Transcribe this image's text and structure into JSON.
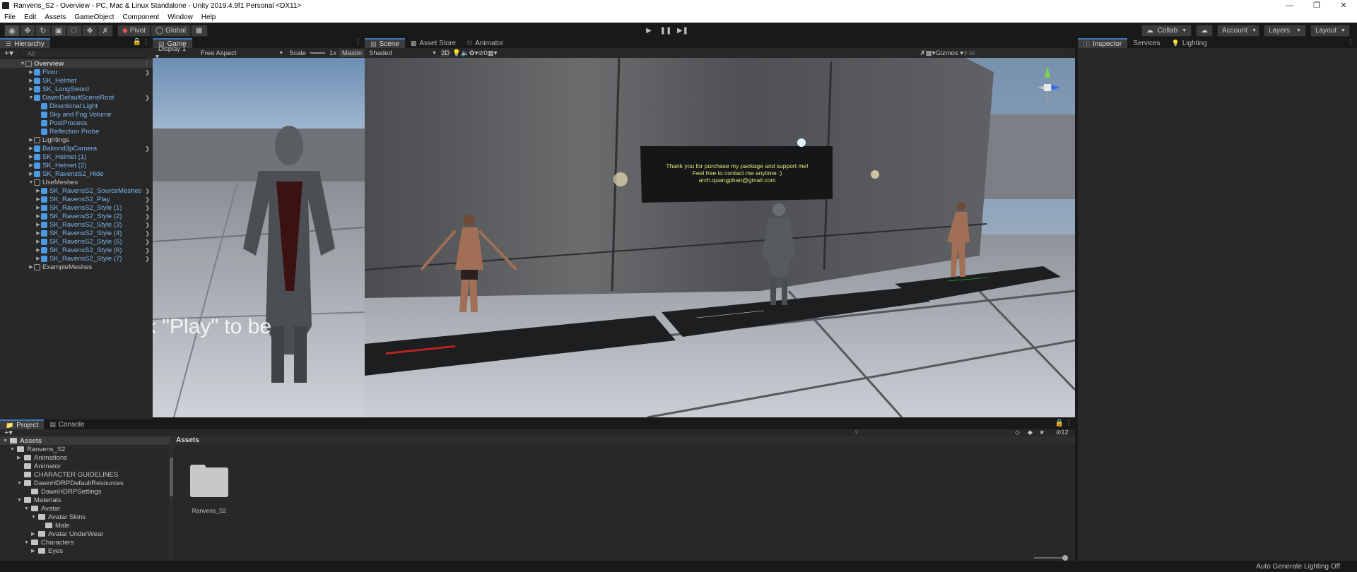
{
  "window": {
    "title": "Ranvens_S2 - Overview - PC, Mac & Linux Standalone - Unity 2019.4.9f1 Personal <DX11>"
  },
  "menu": [
    "File",
    "Edit",
    "Assets",
    "GameObject",
    "Component",
    "Window",
    "Help"
  ],
  "toolbar": {
    "pivot": "Pivot",
    "global": "Global",
    "collab": "Collab",
    "account": "Account",
    "layers": "Layers",
    "layout": "Layout"
  },
  "hierarchy": {
    "tab": "Hierarchy",
    "search_placeholder": "All",
    "items": [
      {
        "label": "Overview",
        "depth": 0,
        "open": true,
        "scene": true
      },
      {
        "label": "Floor",
        "depth": 1,
        "blue": true,
        "chev": true
      },
      {
        "label": "SK_Helmet",
        "depth": 1,
        "blue": true
      },
      {
        "label": "SK_LongSword",
        "depth": 1,
        "blue": true
      },
      {
        "label": "DawnDefaultSceneRoot",
        "depth": 1,
        "blue": true,
        "open": true,
        "chev": true
      },
      {
        "label": "Directional Light",
        "depth": 2,
        "blue": true
      },
      {
        "label": "Sky and Fog Volume",
        "depth": 2,
        "blue": true
      },
      {
        "label": "PostProcess",
        "depth": 2,
        "blue": true
      },
      {
        "label": "Reflection Probe",
        "depth": 2,
        "blue": true
      },
      {
        "label": "Lightings",
        "depth": 1
      },
      {
        "label": "Balrond3pCamera",
        "depth": 1,
        "blue": true,
        "chev": true
      },
      {
        "label": "SK_Helmet (1)",
        "depth": 1,
        "blue": true
      },
      {
        "label": "SK_Helmet (2)",
        "depth": 1,
        "blue": true
      },
      {
        "label": "SK_RavensS2_Hide",
        "depth": 1,
        "blue": true
      },
      {
        "label": "UseMeshes",
        "depth": 1,
        "open": true
      },
      {
        "label": "SK_RavensS2_SourceMeshes",
        "depth": 2,
        "blue": true,
        "chev": true
      },
      {
        "label": "SK_RavensS2_Play",
        "depth": 2,
        "blue": true,
        "chev": true
      },
      {
        "label": "SK_RavensS2_Style (1)",
        "depth": 2,
        "blue": true,
        "chev": true
      },
      {
        "label": "SK_RavensS2_Style (2)",
        "depth": 2,
        "blue": true,
        "chev": true
      },
      {
        "label": "SK_RavensS2_Style (3)",
        "depth": 2,
        "blue": true,
        "chev": true
      },
      {
        "label": "SK_RavensS2_Style (4)",
        "depth": 2,
        "blue": true,
        "chev": true
      },
      {
        "label": "SK_RavensS2_Style (5)",
        "depth": 2,
        "blue": true,
        "chev": true
      },
      {
        "label": "SK_RavensS2_Style (6)",
        "depth": 2,
        "blue": true,
        "chev": true
      },
      {
        "label": "SK_RavensS2_Style (7)",
        "depth": 2,
        "blue": true,
        "chev": true
      },
      {
        "label": "ExampleMeshes",
        "depth": 1
      }
    ]
  },
  "game": {
    "tab": "Game",
    "display": "Display 1",
    "aspect": "Free Aspect",
    "scale_label": "Scale",
    "scale_value": "1x",
    "maximize": "Maxim",
    "overlay_text": "k \"Play\" to be"
  },
  "scene": {
    "tabs": [
      "Scene",
      "Asset Store",
      "Animator"
    ],
    "shading": "Shaded",
    "mode2d": "2D",
    "fx_count": "0",
    "gizmos": "Gizmos",
    "search_placeholder": "All",
    "sign_text": [
      "Thank you for purchase my package and support me!",
      "Feel free to contact me anytime :)",
      "arch.quangphan@gmail.com"
    ]
  },
  "inspector": {
    "tabs": [
      "Inspector",
      "Services",
      "Lighting"
    ]
  },
  "project": {
    "tabs": [
      "Project",
      "Console"
    ],
    "assets_header": "Assets",
    "tree": [
      {
        "label": "Assets",
        "depth": 0,
        "bold": true
      },
      {
        "label": "Ranvens_S2",
        "depth": 1
      },
      {
        "label": "Animations",
        "depth": 2
      },
      {
        "label": "Animator",
        "depth": 2
      },
      {
        "label": "CHARACTER GUIDELINES",
        "depth": 2
      },
      {
        "label": "DawnHDRPDefaultResources",
        "depth": 2
      },
      {
        "label": "DawnHDRPSettings",
        "depth": 3
      },
      {
        "label": "Materials",
        "depth": 2
      },
      {
        "label": "Avatar",
        "depth": 3
      },
      {
        "label": "Avatar Skins",
        "depth": 4
      },
      {
        "label": "Male",
        "depth": 5
      },
      {
        "label": "Avatar UnderWear",
        "depth": 4
      },
      {
        "label": "Characters",
        "depth": 3
      },
      {
        "label": "Eyes",
        "depth": 4
      }
    ],
    "folder_name": "Ranvens_S2",
    "count": "12"
  },
  "status": {
    "text": "Auto Generate Lighting Off"
  },
  "colors": {
    "accent": "#3a79bb",
    "prefab_blue": "#7bb5ec"
  }
}
